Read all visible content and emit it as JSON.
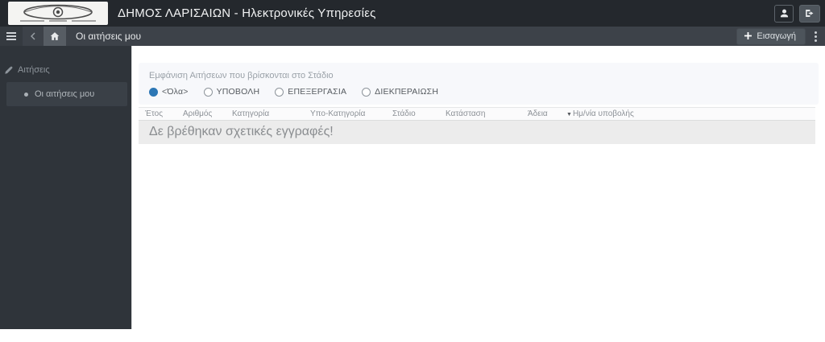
{
  "colors": {
    "topbar_bg": "#24282d",
    "navbar_bg": "#3d4249",
    "sidebar_bg": "#2f343a",
    "sidebar_item_bg": "#3a4047",
    "accent_blue": "#2d77b5",
    "filter_panel_bg": "#f7f8fb",
    "empty_row_bg": "#ececec"
  },
  "topbar": {
    "title": "ΔΗΜΟΣ ΛΑΡΙΣΑΙΩΝ - Ηλεκτρονικές Υπηρεσίες"
  },
  "navbar": {
    "page_title": "Οι αιτήσεις μου",
    "insert_label": "Εισαγωγή"
  },
  "sidebar": {
    "section_label": "Αιτήσεις",
    "items": [
      {
        "label": "Οι αιτήσεις μου",
        "active": true
      }
    ]
  },
  "main": {
    "filter_label": "Εμφάνιση Αιτήσεων που βρίσκονται στο Στάδιο",
    "stage_options": [
      {
        "label": "<Όλα>",
        "selected": true
      },
      {
        "label": "ΥΠΟΒΟΛΗ",
        "selected": false
      },
      {
        "label": "ΕΠΕΞΕΡΓΑΣΙΑ",
        "selected": false
      },
      {
        "label": "ΔΙΕΚΠΕΡΑΙΩΣΗ",
        "selected": false
      }
    ],
    "table": {
      "headers": [
        "Έτος",
        "Αριθμός",
        "Κατηγορία",
        "Υπο-Κατηγορία",
        "Στάδιο",
        "Κατάσταση",
        "Άδεια",
        "Ημ/νία υποβολής"
      ],
      "sort_indicator": "▼",
      "sorted_column": "Ημ/νία υποβολής",
      "rows": [],
      "empty_message": "Δε βρέθηκαν σχετικές εγγραφές!"
    }
  }
}
